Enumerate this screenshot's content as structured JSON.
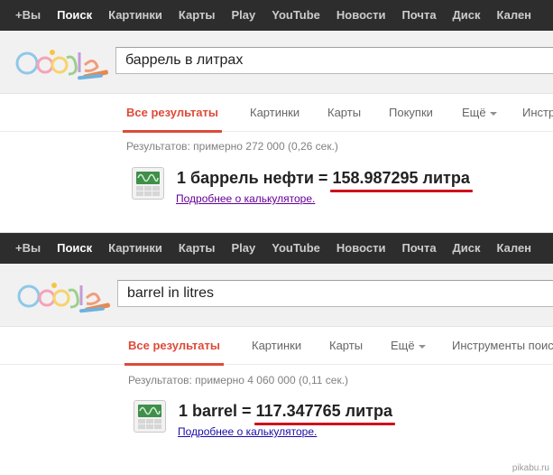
{
  "panels": [
    {
      "topbar": [
        "+Вы",
        "Поиск",
        "Картинки",
        "Карты",
        "Play",
        "YouTube",
        "Новости",
        "Почта",
        "Диск",
        "Кален"
      ],
      "search_query": "баррель в литрах",
      "tabs": [
        "Все результаты",
        "Картинки",
        "Карты",
        "Покупки",
        "Ещё",
        "Инстр"
      ],
      "stats": "Результатов: примерно 272 000 (0,26 сек.)",
      "answer_prefix": "1 баррель нефти = ",
      "answer_value": "158.987295 литра",
      "calc_link": "Подробнее о калькуляторе."
    },
    {
      "topbar": [
        "+Вы",
        "Поиск",
        "Картинки",
        "Карты",
        "Play",
        "YouTube",
        "Новости",
        "Почта",
        "Диск",
        "Кален"
      ],
      "search_query": "barrel in litres",
      "tabs": [
        "Все результаты",
        "Картинки",
        "Карты",
        "Ещё",
        "Инструменты поис"
      ],
      "stats": "Результатов: примерно 4 060 000 (0,11 сек.)",
      "answer_prefix": "1 barrel = ",
      "answer_value": "117.347765 литра",
      "calc_link": "Подробнее о калькуляторе."
    }
  ],
  "watermark": "pikabu.ru",
  "colors": {
    "topbar": "#2d2d2d",
    "accent": "#dd4b39",
    "underline": "#d0101a",
    "link": "#1a0dab",
    "visited_link": "#660099"
  }
}
